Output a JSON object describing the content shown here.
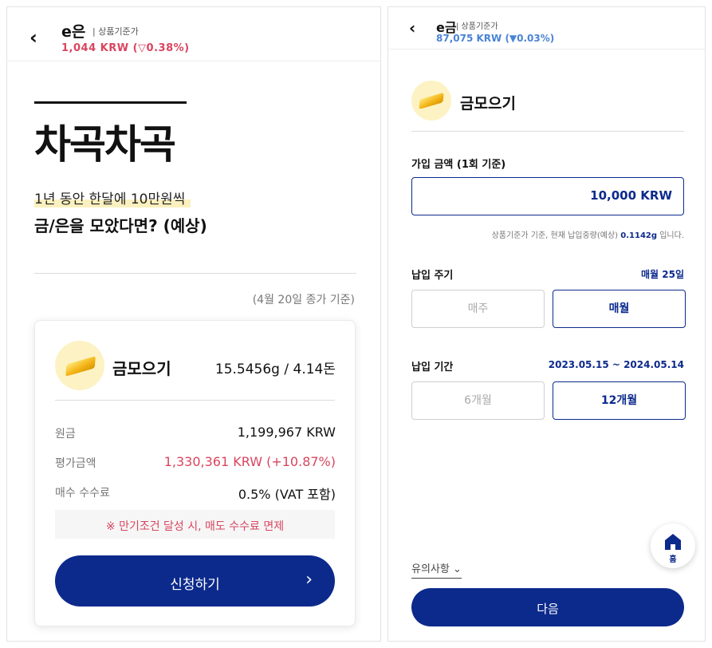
{
  "left": {
    "header": {
      "title": "e은",
      "subtitle": "| 상품기준가",
      "price": "1,044 KRW (▽0.38%)"
    },
    "hero": "차곡차곡",
    "subline1": "1년 동안 한달에 10만원씩",
    "subline2": "금/은을 모았다면? (예상)",
    "basis_note": "(4월 20일 종가 기준)",
    "card": {
      "product_name": "금모으기",
      "weight": "15.5456g / 4.14돈",
      "rows": [
        {
          "label": "원금",
          "value": "1,199,967 KRW"
        },
        {
          "label": "평가금액",
          "value": "1,330,361 KRW (+10.87%)"
        },
        {
          "label": "매수 수수료",
          "value": "0.5% (VAT 포함)"
        }
      ],
      "notice": "※ 만기조건 달성 시, 매도 수수료 면제",
      "apply_label": "신청하기",
      "apply_chevron": "›"
    }
  },
  "right": {
    "header": {
      "title": "e금",
      "subtitle": "| 상품기준가",
      "price": "87,075 KRW (▼0.03%)"
    },
    "product_title": "금모으기",
    "amount": {
      "label": "가입 금액 (1회 기준)",
      "value": "10,000 KRW",
      "hint_prefix": "상품기준가 기준, 현재 납입중량(예상)",
      "hint_weight": "0.1142g",
      "hint_suffix": "입니다."
    },
    "cycle": {
      "label": "납입 주기",
      "summary": "매월 25일",
      "options": [
        "매주",
        "매월"
      ],
      "selected": "매월"
    },
    "period": {
      "label": "납입 기간",
      "summary": "2023.05.15 ~ 2024.05.14",
      "options": [
        "6개월",
        "12개월"
      ],
      "selected": "12개월"
    },
    "notes_label": "유의사항 ⌄",
    "home_label": "홈",
    "next_label": "다음"
  },
  "colors": {
    "primary": "#0c2a8c",
    "down_red": "#d9455f",
    "down_blue": "#4a83d6",
    "gold": "#f4b619",
    "highlight": "#fbf0bf"
  }
}
